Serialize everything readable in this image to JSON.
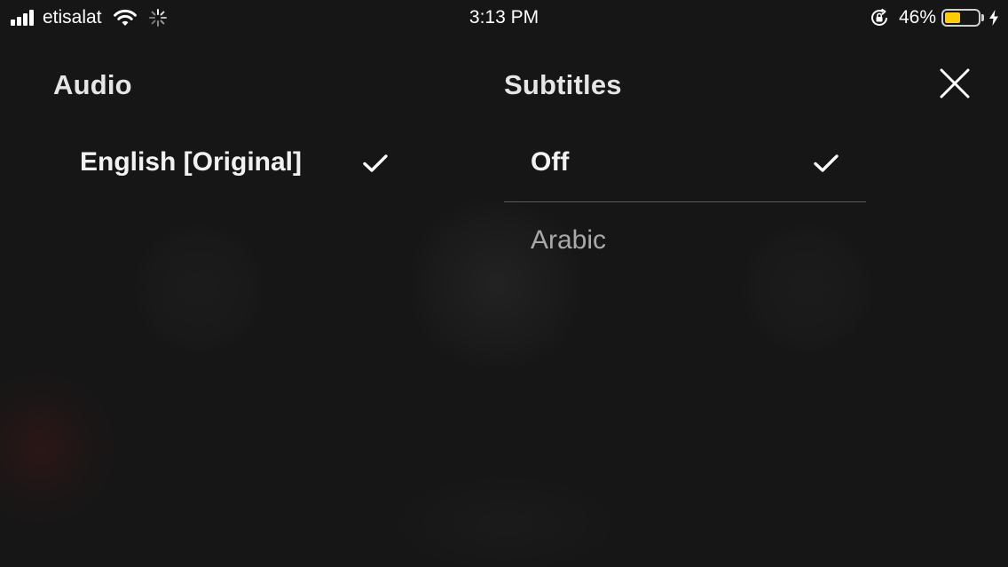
{
  "status_bar": {
    "carrier": "etisalat",
    "time": "3:13 PM",
    "battery_percent": "46%",
    "battery_level": 0.46,
    "battery_color": "#ffcc00",
    "icons": [
      "signal-bars-icon",
      "wifi-icon",
      "activity-spinner-icon",
      "rotation-lock-icon",
      "battery-icon",
      "charging-bolt-icon"
    ]
  },
  "audio": {
    "heading": "Audio",
    "options": [
      {
        "label": "English [Original]",
        "selected": true
      }
    ]
  },
  "subtitles": {
    "heading": "Subtitles",
    "options": [
      {
        "label": "Off",
        "selected": true
      },
      {
        "label": "Arabic",
        "selected": false
      }
    ]
  },
  "close_icon": "close-icon",
  "check_icon": "checkmark-icon",
  "colors": {
    "background": "#161616",
    "selected_text": "#f2f2f2",
    "unselected_text": "#a9a9a9",
    "divider": "#5a5a5a"
  }
}
